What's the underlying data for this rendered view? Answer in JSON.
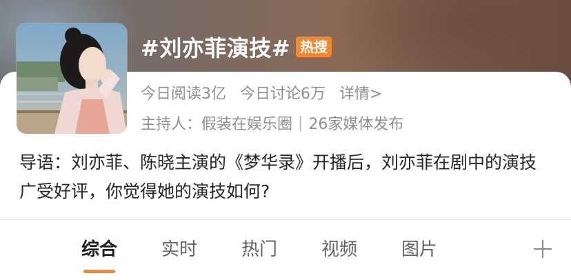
{
  "topic": {
    "title": "#刘亦菲演技#",
    "badge": "热搜",
    "reads": "今日阅读3亿",
    "discussions": "今日讨论6万",
    "details_link": "详情>",
    "host": "主持人：假装在娱乐圈",
    "separator": "|",
    "media": "26家媒体发布",
    "intro": "导语：刘亦菲、陈晓主演的《梦华录》开播后，刘亦菲在剧中的演技广受好评，你觉得她的演技如何?"
  },
  "tabs": [
    {
      "label": "综合",
      "active": true
    },
    {
      "label": "实时",
      "active": false
    },
    {
      "label": "热门",
      "active": false
    },
    {
      "label": "视频",
      "active": false
    },
    {
      "label": "图片",
      "active": false
    }
  ],
  "colors": {
    "accent": "#f7872f",
    "badge_bg": "#f7872f",
    "meta_text": "#8f8f8f",
    "body_text": "#262626"
  },
  "icons": {
    "add_tab": "plus-icon"
  }
}
